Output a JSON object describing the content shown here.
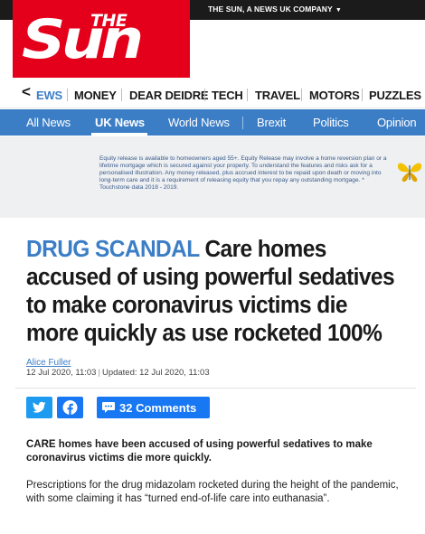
{
  "masthead": {
    "logo_small": "THE",
    "logo_big": "Sun",
    "company_link": "THE SUN, A NEWS UK COMPANY",
    "company_caret": "▼"
  },
  "section_nav": {
    "back_glyph": "<",
    "items": [
      "EWS",
      "MONEY",
      "DEAR DEIDRE",
      "TECH",
      "TRAVEL",
      "MOTORS",
      "PUZZLES"
    ]
  },
  "blue_nav": {
    "items": [
      "All News",
      "UK News",
      "World News",
      "Brexit",
      "Politics",
      "Opinion"
    ],
    "active": "UK News"
  },
  "ad": {
    "text": "Equity release is available to homeowners aged 55+. Equity Release may involve a home reversion plan or a lifetime mortgage which is secured against your property. To understand the features and risks ask for a personalised illustration. Any money released, plus accrued interest to be repaid upon death or moving into long-term care and it is a requirement of releasing equity that you repay any outstanding mortgage. * Touchstone data 2018 - 2019."
  },
  "article": {
    "kicker": "DRUG SCANDAL",
    "headline": "Care homes accused of using powerful sedatives to make coronavirus victims die more quickly as use rocketed 100%",
    "author": "Alice Fuller",
    "published": "12 Jul 2020, 11:03",
    "updated": "Updated: 12 Jul 2020, 11:03",
    "date_separator": "|",
    "comments_label": "32 Comments",
    "standfirst": "CARE homes have been accused of using powerful sedatives to make coronavirus victims die more quickly.",
    "paragraph_1": "Prescriptions for the drug midazolam rocketed during the height of the pandemic, with some claiming it has “turned end-of-life care into euthanasia”."
  },
  "colors": {
    "brand_red": "#e4001b",
    "news_blue": "#3c7ec6",
    "twitter_blue": "#1d9bf0",
    "facebook_blue": "#1877f2"
  },
  "icons": [
    "twitter-icon",
    "facebook-icon",
    "comment-bubble-icon",
    "butterfly-icon",
    "chevron-left-icon",
    "chevron-down-icon"
  ]
}
